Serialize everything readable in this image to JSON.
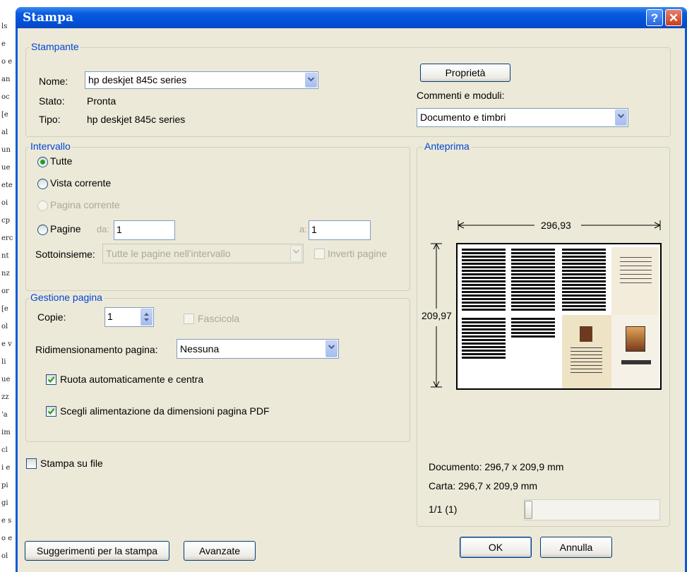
{
  "background_doc": {
    "fragments": [
      "ls",
      "e",
      "o e",
      "an",
      "oc",
      "[e",
      "al",
      "un",
      "ue",
      "ete",
      "oi",
      "cp",
      "erc",
      "nt",
      "nz",
      "or",
      "[e",
      "ol",
      "e v",
      "li",
      "ue",
      "zz",
      "'a",
      "im",
      "cl",
      "i e",
      "pi",
      "gi",
      "e s",
      "o e",
      "ol"
    ]
  },
  "window": {
    "title": "Stampa",
    "help_label": "?",
    "close_label": "✕"
  },
  "printer": {
    "legend": "Stampante",
    "name_label": "Nome:",
    "name_value": "hp deskjet 845c series",
    "status_label": "Stato:",
    "status_value": "Pronta",
    "type_label": "Tipo:",
    "type_value": "hp deskjet 845c series",
    "properties_button": "Proprietà",
    "comments_label": "Commenti e moduli:",
    "comments_value": "Documento e  timbri"
  },
  "range": {
    "legend": "Intervallo",
    "all_label": "Tutte",
    "current_view_label": "Vista corrente",
    "current_page_label": "Pagina corrente",
    "pages_label": "Pagine",
    "from_label": "da:",
    "from_value": "1",
    "to_label": "a:",
    "to_value": "1",
    "subset_label": "Sottoinsieme:",
    "subset_value": "Tutte le pagine nell'intervallo",
    "reverse_label": "Inverti pagine"
  },
  "page_handling": {
    "legend": "Gestione pagina",
    "copies_label": "Copie:",
    "copies_value": "1",
    "collate_label": "Fascicola",
    "scaling_label": "Ridimensionamento pagina:",
    "scaling_value": "Nessuna",
    "auto_rotate_label": "Ruota automaticamente e centra",
    "choose_source_label": "Scegli alimentazione da dimensioni pagina PDF"
  },
  "print_to_file_label": "Stampa su file",
  "preview": {
    "legend": "Anteprima",
    "width_dim": "296,93",
    "height_dim": "209,97",
    "document_size": "Documento: 296,7 x 209,9 mm",
    "paper_size": "Carta: 296,7 x 209,9 mm",
    "page_counter": "1/1 (1)",
    "slider_position": 0
  },
  "buttons": {
    "tips": "Suggerimenti per la stampa",
    "advanced": "Avanzate",
    "ok": "OK",
    "cancel": "Annulla"
  },
  "colors": {
    "title_bar": "#0a5ad8",
    "legend_text": "#0046d5",
    "dialog_bg": "#ece9d8",
    "check_mark": "#21a121"
  }
}
